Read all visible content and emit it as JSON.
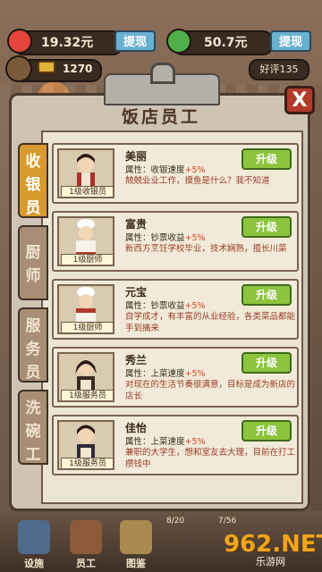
{
  "currency": {
    "cash_primary": "19.32元",
    "withdraw_primary": "提现",
    "cash_secondary": "50.7元",
    "withdraw_secondary": "提现",
    "coins": "1270",
    "reviews": "好评135"
  },
  "panel": {
    "title": "饭店员工",
    "close_label": "X",
    "tabs": [
      {
        "label": "收银员",
        "active": true
      },
      {
        "label": "厨师",
        "active": false
      },
      {
        "label": "服务员",
        "active": false
      },
      {
        "label": "洗碗工",
        "active": false
      }
    ]
  },
  "staff": [
    {
      "name": "美丽",
      "level": "1级收银员",
      "attr_label": "属性：",
      "attr_name": "收银速度",
      "attr_pct": "+5%",
      "desc": "兢兢业业工作，摸鱼是什么？我不知道",
      "button": "升级",
      "icon": "cashier-woman"
    },
    {
      "name": "富贵",
      "level": "1级厨师",
      "attr_label": "属性：",
      "attr_name": "钞票收益",
      "attr_pct": "+5%",
      "desc": "新西方烹饪学校毕业，技术娴熟，擅长川菜",
      "button": "升级",
      "icon": "chef-man"
    },
    {
      "name": "元宝",
      "level": "1级厨师",
      "attr_label": "属性：",
      "attr_name": "钞票收益",
      "attr_pct": "+5%",
      "desc": "自学成才，有丰富的从业经验，各类菜品都能手到擒来",
      "button": "升级",
      "icon": "chef-woman"
    },
    {
      "name": "秀兰",
      "level": "1级服务员",
      "attr_label": "属性：",
      "attr_name": "上菜速度",
      "attr_pct": "+5%",
      "desc": "对现在的生活节奏很满意，目标是成为新店的店长",
      "button": "升级",
      "icon": "waitress"
    },
    {
      "name": "佳怡",
      "level": "1级服务员",
      "attr_label": "属性：",
      "attr_name": "上菜速度",
      "attr_pct": "+5%",
      "desc": "兼职的大学生，想和室友去大理，目前在打工攒钱中",
      "button": "升级",
      "icon": "waitress-student"
    }
  ],
  "bottom_nav": [
    {
      "label": "设施"
    },
    {
      "label": "员工"
    },
    {
      "label": "图鉴"
    }
  ],
  "bottom_badges": [
    "8/20",
    "7/56"
  ],
  "watermark": {
    "big": "962.NET",
    "small": "乐游网"
  },
  "colors": {
    "accent_gold": "#d69a2e",
    "upgrade_green": "#8cc43e",
    "close_red": "#b23a2a",
    "withdraw_blue": "#6ab0d1",
    "percent_red": "#d8452a"
  }
}
